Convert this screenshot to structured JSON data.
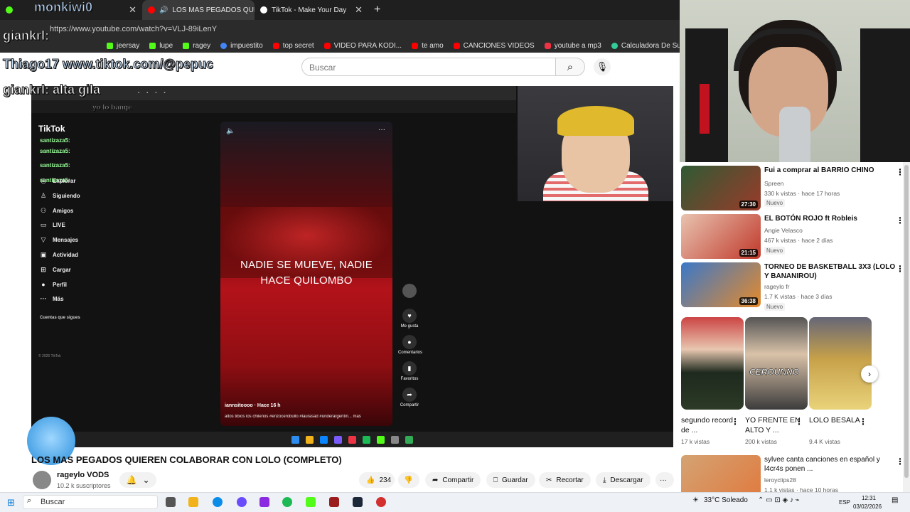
{
  "tabs": [
    {
      "label": "",
      "active": false
    },
    {
      "label": "LOS MAS PEGADOS QUIEREN",
      "active": true
    },
    {
      "label": "TikTok - Make Your Day",
      "active": false
    }
  ],
  "new_tab": "+",
  "url": "https://www.youtube.com/watch?v=VLJ-89iLenY",
  "bookmarks": [
    "jeersay",
    "lupe",
    "ragey",
    "impuestito",
    "top secret",
    "VIDEO PARA KODI...",
    "te amo",
    "CANCIONES VIDEOS",
    "youtube a mp3",
    "Calculadora De Su..."
  ],
  "youtube": {
    "search_placeholder": "Buscar",
    "video_title": "LOS MAS PEGADOS QUIEREN COLABORAR CON LOLO (COMPLETO)",
    "channel_name": "rageylo VODS",
    "subscribers": "10.2 k suscriptores",
    "likes": "234",
    "actions": {
      "share": "Compartir",
      "save": "Guardar",
      "clip": "Recortar",
      "download": "Descargar"
    }
  },
  "stream_overlay": {
    "line1": "monkiwi0",
    "line2": "giankrl:",
    "line3": "Thiago17  www.tiktok.com/@pepuc",
    "line4": "giankrl: alta gila",
    "line5": "yo lo banqe"
  },
  "tiktok": {
    "logo": "TikTok",
    "nav": [
      "Explorar",
      "Siguiendo",
      "Amigos",
      "LIVE",
      "Mensajes",
      "Actividad",
      "Cargar",
      "Perfil",
      "Más"
    ],
    "following_header": "Cuentas que sigues",
    "copyright": "© 2026 TikTok",
    "chat_user": "santizaza5:",
    "overlay_text_1": "NADIE SE MUEVE, NADIE",
    "overlay_text_2": "HACE QUILOMBO",
    "author": "iannsitoooo · Hace 16 h",
    "caption": "altos tibios los chilenos #enzocerobullo #laurasad #underargentin... más",
    "action_labels": [
      "Me gusta",
      "Comentarios",
      "Favoritos",
      "Compartir"
    ]
  },
  "recommendations": [
    {
      "title": "Fui a comprar al BARRIO CHINO",
      "channel": "Spreen",
      "meta": "330 k vistas · hace 17 horas",
      "badge": "Nuevo",
      "duration": "27:30",
      "color": "#3a6a3e"
    },
    {
      "title": "EL BOTÓN ROJO ft Robleis",
      "channel": "Angie Velasco",
      "meta": "467 k vistas · hace 2 días",
      "badge": "Nuevo",
      "duration": "21:15",
      "color": "#c9463d"
    },
    {
      "title": "TORNEO DE BASKETBALL 3X3 (LOLO Y BANANIROU)",
      "channel": "rageylo fr",
      "meta": "1.7 K vistas · hace 3 días",
      "badge": "Nuevo",
      "duration": "36:38",
      "color": "#e58a2b"
    }
  ],
  "shorts": [
    {
      "title": "segundo record de ...",
      "views": "17 k vistas",
      "color": "#2f3a2a"
    },
    {
      "title": "YO FRENTE EN ALTO Y ...",
      "views": "200 k vistas",
      "color": "#3c3c3c",
      "label": "CEROUNNO"
    },
    {
      "title": "LOLO BESALA",
      "views": "9.4 K vistas",
      "color": "#c7a14a"
    }
  ],
  "next_rec": {
    "title": "sylvee canta canciones en español y l4cr4s ponen ...",
    "channel": "leroyclips28",
    "meta": "1.1 k vistas · hace 10 horas"
  },
  "taskbar": {
    "search": "Buscar",
    "weather": "33°C  Soleado",
    "lang": "ESP",
    "time": "12:31",
    "date": "03/02/2026"
  }
}
